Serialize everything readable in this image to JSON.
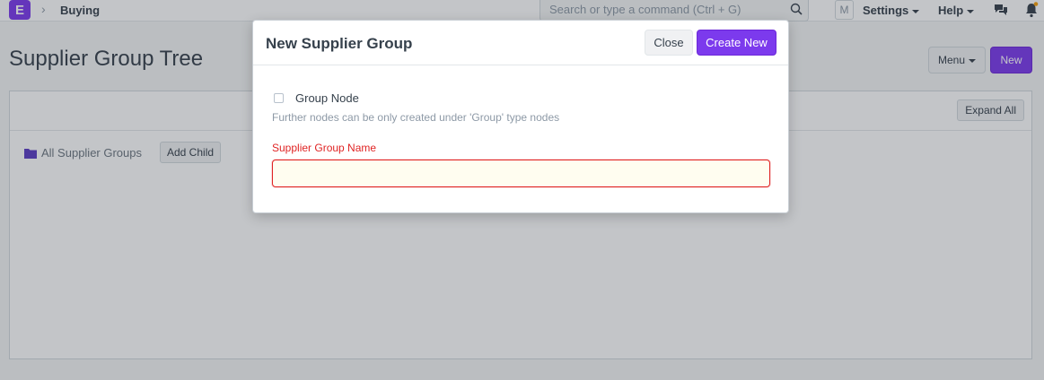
{
  "navbar": {
    "logo_letter": "E",
    "breadcrumb": "Buying",
    "search_placeholder": "Search or type a command (Ctrl + G)",
    "avatar_letter": "M",
    "settings_label": "Settings",
    "help_label": "Help"
  },
  "page": {
    "title": "Supplier Group Tree",
    "menu_label": "Menu",
    "new_label": "New",
    "expand_all_label": "Expand All",
    "tree_root_label": "All Supplier Groups",
    "add_child_label": "Add Child"
  },
  "modal": {
    "title": "New Supplier Group",
    "close_label": "Close",
    "create_label": "Create New",
    "group_node_label": "Group Node",
    "group_node_checked": false,
    "help_text": "Further nodes can be only created under 'Group' type nodes",
    "name_field_label": "Supplier Group Name",
    "name_field_value": ""
  },
  "colors": {
    "accent": "#7c3aed",
    "error": "#e02424",
    "notification_dot": "#f59e0b"
  },
  "icons": {
    "search": "search-icon",
    "chat": "chat-icon",
    "bell": "bell-icon",
    "folder": "folder-icon",
    "chevron": "chevron-right-icon"
  }
}
